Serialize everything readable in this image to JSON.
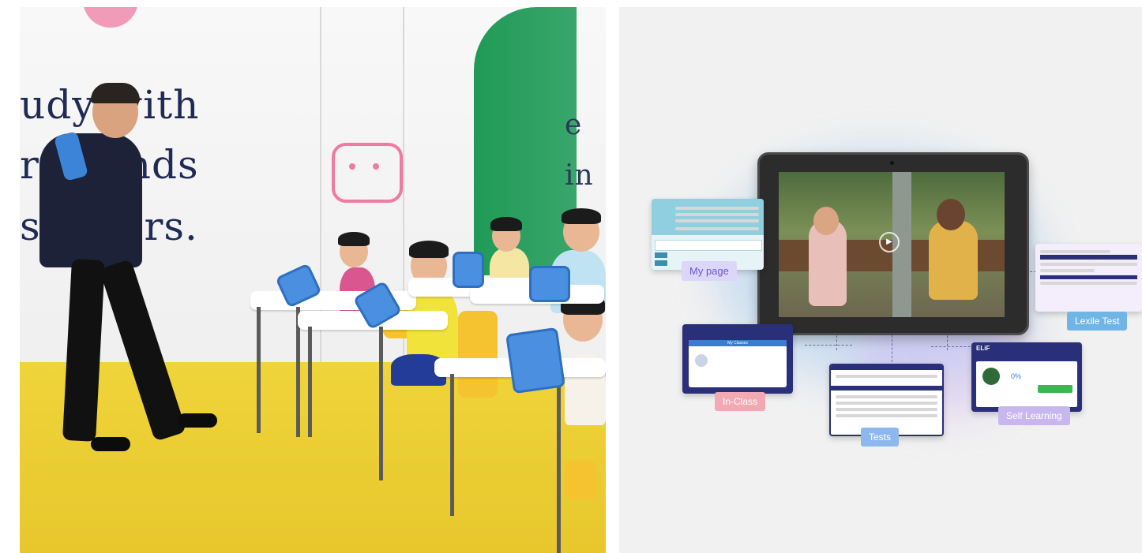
{
  "photo": {
    "wall_text_lines": [
      "udy with",
      "r  friends",
      "st  chers."
    ],
    "glass_text": "e in"
  },
  "diagram": {
    "labels": {
      "my_page": "My page",
      "in_class": "In-Class",
      "tests": "Tests",
      "self_learning": "Self Learning",
      "lexile_test": "Lexile Test"
    },
    "self_learning_card": {
      "logo": "ELiF",
      "percent": "0%"
    },
    "in_class_card": {
      "header": "My Classes"
    },
    "colors": {
      "my_page": "#dcd6f8",
      "in_class": "#f1a9b3",
      "tests": "#8db8ee",
      "self_learning": "#c8b6ef",
      "lexile_test": "#6fb6e6",
      "card_navy": "#2a2f7a"
    }
  }
}
